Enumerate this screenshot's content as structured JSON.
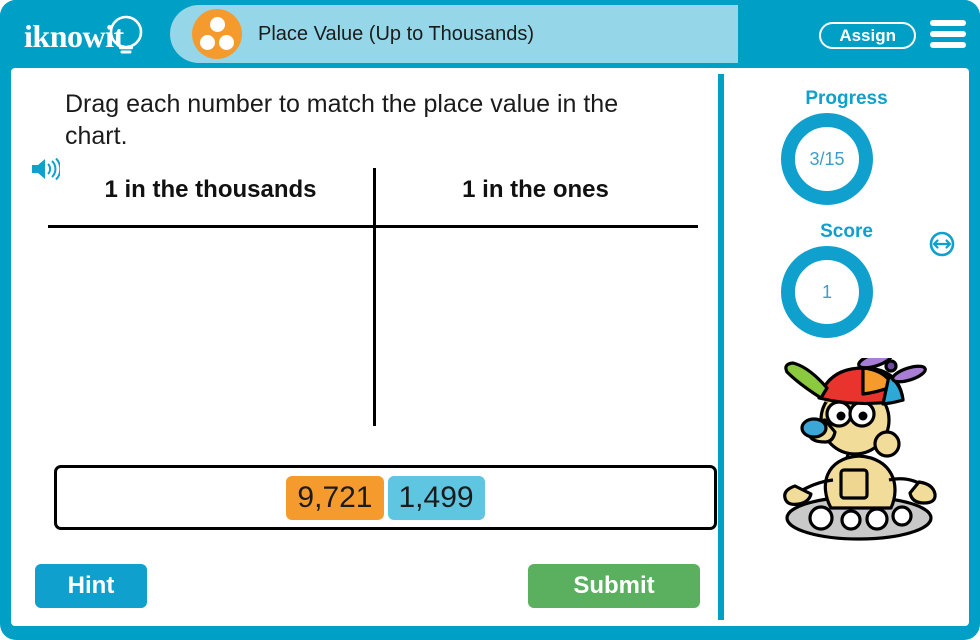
{
  "header": {
    "logo_text": "iknowit",
    "logo_icon": "lightbulb-icon",
    "activity_title": "Place Value (Up to Thousands)",
    "title_icon": "three-dots-icon",
    "assign_label": "Assign",
    "menu_icon": "hamburger-menu-icon"
  },
  "main": {
    "audio_icon": "speaker-icon",
    "question": "Drag each number to match the place value in the chart.",
    "chart": {
      "columns": [
        {
          "label": "1 in the thousands",
          "items": []
        },
        {
          "label": "1 in the ones",
          "items": []
        }
      ]
    },
    "tray": {
      "tiles": [
        {
          "value": "9,721",
          "color": "#f59b2e"
        },
        {
          "value": "1,499",
          "color": "#5ec6e0"
        }
      ]
    },
    "hint_label": "Hint",
    "submit_label": "Submit"
  },
  "sidebar": {
    "progress_label": "Progress",
    "progress_value": "3/15",
    "score_label": "Score",
    "score_value": "1",
    "mascot_icon": "robot-mascot-icon",
    "resize_icon": "horizontal-resize-icon"
  },
  "colors": {
    "frame": "#00a0c6",
    "accent": "#0fa0ce",
    "title_pill": "#95d7e8",
    "orange": "#f59b2e",
    "blue_tile": "#5ec6e0",
    "submit_green": "#5bb060"
  }
}
